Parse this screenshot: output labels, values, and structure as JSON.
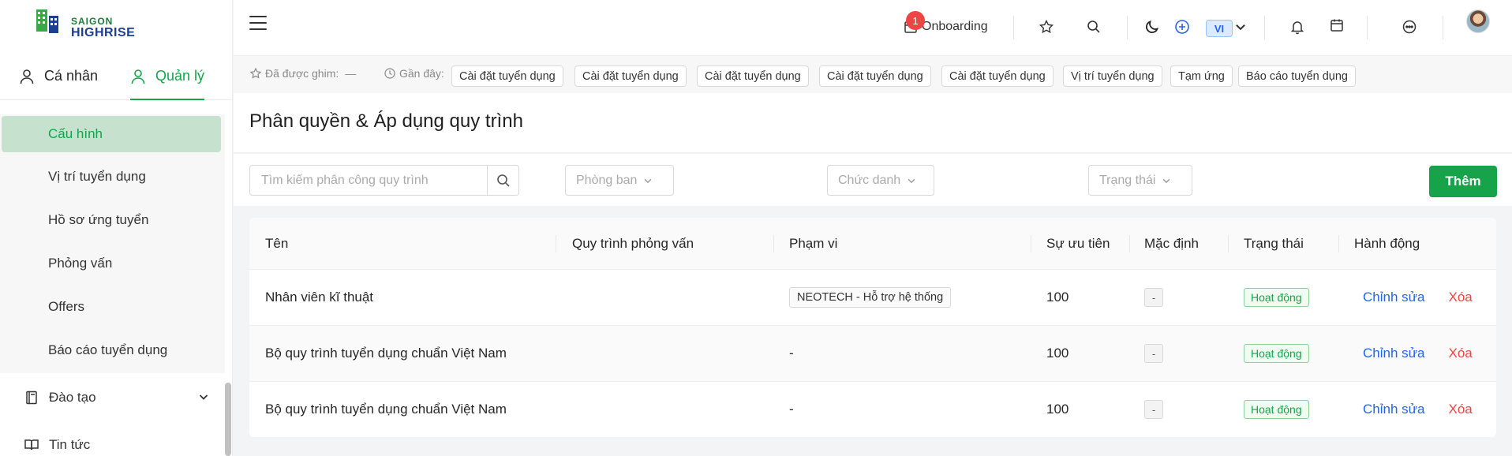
{
  "brand": {
    "line1": "SAIGON",
    "line2": "HIGHRISE"
  },
  "sidebar": {
    "tabs": [
      {
        "label": "Cá nhân"
      },
      {
        "label": "Quản lý"
      }
    ],
    "sub_items": [
      {
        "label": "Cấu hình"
      },
      {
        "label": "Vị trí tuyển dụng"
      },
      {
        "label": "Hồ sơ ứng tuyển"
      },
      {
        "label": "Phỏng vấn"
      },
      {
        "label": "Offers"
      },
      {
        "label": "Báo cáo tuyển dụng"
      }
    ],
    "groups": [
      {
        "label": "Đào tạo",
        "icon": "book-icon"
      },
      {
        "label": "Tin tức",
        "icon": "news-icon"
      }
    ]
  },
  "header": {
    "onboarding_label": "Onboarding",
    "onboarding_badge": "1",
    "language": "VI"
  },
  "pinbar": {
    "pinned_label": "Đã được ghim:",
    "pinned_value": "—",
    "recent_label": "Gần đây:",
    "chips": [
      "Cài đặt tuyển dụng",
      "Cài đặt tuyển dụng",
      "Cài đặt tuyển dụng",
      "Cài đặt tuyển dụng",
      "Cài đặt tuyển dụng",
      "Vị trí tuyển dụng",
      "Tạm ứng",
      "Báo cáo tuyển dụng"
    ]
  },
  "page": {
    "title": "Phân quyền & Áp dụng quy trình",
    "search_placeholder": "Tìm kiếm phân công quy trình",
    "filter_department": "Phòng ban",
    "filter_title": "Chức danh",
    "filter_status": "Trạng thái",
    "add_button": "Thêm"
  },
  "table": {
    "columns": [
      "Tên",
      "Quy trình phỏng vấn",
      "Phạm vi",
      "Sự ưu tiên",
      "Mặc định",
      "Trạng thái",
      "Hành động"
    ],
    "rows": [
      {
        "name": "Nhân viên kĩ thuật",
        "process": "",
        "scope": "NEOTECH - Hỗ trợ hệ thống",
        "scope_tag": true,
        "priority": "100",
        "default": "-",
        "status": "Hoạt động",
        "edit": "Chỉnh sửa",
        "delete": "Xóa"
      },
      {
        "name": "Bộ quy trình tuyển dụng chuẩn Việt Nam",
        "process": "",
        "scope": "-",
        "scope_tag": false,
        "priority": "100",
        "default": "-",
        "status": "Hoạt động",
        "edit": "Chỉnh sửa",
        "delete": "Xóa"
      },
      {
        "name": "Bộ quy trình tuyển dụng chuẩn Việt Nam",
        "process": "",
        "scope": "-",
        "scope_tag": false,
        "priority": "100",
        "default": "-",
        "status": "Hoạt động",
        "edit": "Chỉnh sửa",
        "delete": "Xóa"
      }
    ]
  },
  "colors": {
    "accent": "#16a34a",
    "link": "#2563eb",
    "danger": "#ef4444",
    "active_bg": "#c6e2cf"
  }
}
